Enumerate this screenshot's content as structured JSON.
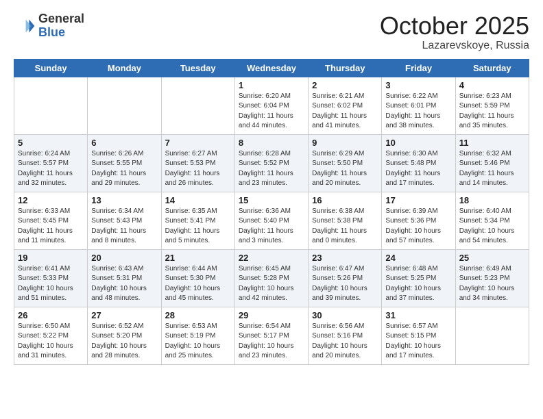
{
  "header": {
    "logo_general": "General",
    "logo_blue": "Blue",
    "title": "October 2025",
    "location": "Lazarevskoye, Russia"
  },
  "days_of_week": [
    "Sunday",
    "Monday",
    "Tuesday",
    "Wednesday",
    "Thursday",
    "Friday",
    "Saturday"
  ],
  "weeks": [
    [
      {
        "day": "",
        "text": ""
      },
      {
        "day": "",
        "text": ""
      },
      {
        "day": "",
        "text": ""
      },
      {
        "day": "1",
        "text": "Sunrise: 6:20 AM\nSunset: 6:04 PM\nDaylight: 11 hours\nand 44 minutes."
      },
      {
        "day": "2",
        "text": "Sunrise: 6:21 AM\nSunset: 6:02 PM\nDaylight: 11 hours\nand 41 minutes."
      },
      {
        "day": "3",
        "text": "Sunrise: 6:22 AM\nSunset: 6:01 PM\nDaylight: 11 hours\nand 38 minutes."
      },
      {
        "day": "4",
        "text": "Sunrise: 6:23 AM\nSunset: 5:59 PM\nDaylight: 11 hours\nand 35 minutes."
      }
    ],
    [
      {
        "day": "5",
        "text": "Sunrise: 6:24 AM\nSunset: 5:57 PM\nDaylight: 11 hours\nand 32 minutes."
      },
      {
        "day": "6",
        "text": "Sunrise: 6:26 AM\nSunset: 5:55 PM\nDaylight: 11 hours\nand 29 minutes."
      },
      {
        "day": "7",
        "text": "Sunrise: 6:27 AM\nSunset: 5:53 PM\nDaylight: 11 hours\nand 26 minutes."
      },
      {
        "day": "8",
        "text": "Sunrise: 6:28 AM\nSunset: 5:52 PM\nDaylight: 11 hours\nand 23 minutes."
      },
      {
        "day": "9",
        "text": "Sunrise: 6:29 AM\nSunset: 5:50 PM\nDaylight: 11 hours\nand 20 minutes."
      },
      {
        "day": "10",
        "text": "Sunrise: 6:30 AM\nSunset: 5:48 PM\nDaylight: 11 hours\nand 17 minutes."
      },
      {
        "day": "11",
        "text": "Sunrise: 6:32 AM\nSunset: 5:46 PM\nDaylight: 11 hours\nand 14 minutes."
      }
    ],
    [
      {
        "day": "12",
        "text": "Sunrise: 6:33 AM\nSunset: 5:45 PM\nDaylight: 11 hours\nand 11 minutes."
      },
      {
        "day": "13",
        "text": "Sunrise: 6:34 AM\nSunset: 5:43 PM\nDaylight: 11 hours\nand 8 minutes."
      },
      {
        "day": "14",
        "text": "Sunrise: 6:35 AM\nSunset: 5:41 PM\nDaylight: 11 hours\nand 5 minutes."
      },
      {
        "day": "15",
        "text": "Sunrise: 6:36 AM\nSunset: 5:40 PM\nDaylight: 11 hours\nand 3 minutes."
      },
      {
        "day": "16",
        "text": "Sunrise: 6:38 AM\nSunset: 5:38 PM\nDaylight: 11 hours\nand 0 minutes."
      },
      {
        "day": "17",
        "text": "Sunrise: 6:39 AM\nSunset: 5:36 PM\nDaylight: 10 hours\nand 57 minutes."
      },
      {
        "day": "18",
        "text": "Sunrise: 6:40 AM\nSunset: 5:34 PM\nDaylight: 10 hours\nand 54 minutes."
      }
    ],
    [
      {
        "day": "19",
        "text": "Sunrise: 6:41 AM\nSunset: 5:33 PM\nDaylight: 10 hours\nand 51 minutes."
      },
      {
        "day": "20",
        "text": "Sunrise: 6:43 AM\nSunset: 5:31 PM\nDaylight: 10 hours\nand 48 minutes."
      },
      {
        "day": "21",
        "text": "Sunrise: 6:44 AM\nSunset: 5:30 PM\nDaylight: 10 hours\nand 45 minutes."
      },
      {
        "day": "22",
        "text": "Sunrise: 6:45 AM\nSunset: 5:28 PM\nDaylight: 10 hours\nand 42 minutes."
      },
      {
        "day": "23",
        "text": "Sunrise: 6:47 AM\nSunset: 5:26 PM\nDaylight: 10 hours\nand 39 minutes."
      },
      {
        "day": "24",
        "text": "Sunrise: 6:48 AM\nSunset: 5:25 PM\nDaylight: 10 hours\nand 37 minutes."
      },
      {
        "day": "25",
        "text": "Sunrise: 6:49 AM\nSunset: 5:23 PM\nDaylight: 10 hours\nand 34 minutes."
      }
    ],
    [
      {
        "day": "26",
        "text": "Sunrise: 6:50 AM\nSunset: 5:22 PM\nDaylight: 10 hours\nand 31 minutes."
      },
      {
        "day": "27",
        "text": "Sunrise: 6:52 AM\nSunset: 5:20 PM\nDaylight: 10 hours\nand 28 minutes."
      },
      {
        "day": "28",
        "text": "Sunrise: 6:53 AM\nSunset: 5:19 PM\nDaylight: 10 hours\nand 25 minutes."
      },
      {
        "day": "29",
        "text": "Sunrise: 6:54 AM\nSunset: 5:17 PM\nDaylight: 10 hours\nand 23 minutes."
      },
      {
        "day": "30",
        "text": "Sunrise: 6:56 AM\nSunset: 5:16 PM\nDaylight: 10 hours\nand 20 minutes."
      },
      {
        "day": "31",
        "text": "Sunrise: 6:57 AM\nSunset: 5:15 PM\nDaylight: 10 hours\nand 17 minutes."
      },
      {
        "day": "",
        "text": ""
      }
    ]
  ]
}
